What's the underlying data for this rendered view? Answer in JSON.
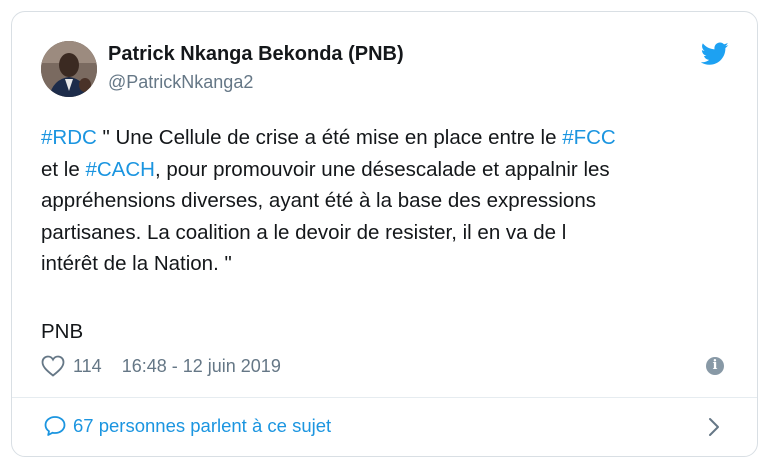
{
  "tweet": {
    "author": {
      "name": "Patrick Nkanga Bekonda (PNB)",
      "handle": "@PatrickNkanga2",
      "avatar_icon": "avatar"
    },
    "text": {
      "line1_tag1": "#RDC",
      "line1_rest": " \" Une Cellule de crise a été mise en place entre le ",
      "line1_tag2": "#FCC",
      "line2_start": "et le ",
      "line2_tag": "#CACH",
      "line2_rest": ", pour promouvoir une désescalade et appalnir les",
      "line3": "appréhensions diverses, ayant été à la base des expressions",
      "line4": "partisanes. La coalition a le devoir de resister, il en va de l",
      "line5": "intérêt de la Nation. \""
    },
    "signature": "PNB",
    "likes": "114",
    "timestamp": "16:48 - 12 juin 2019",
    "footer_label": "67 personnes parlent à ce sujet"
  },
  "colors": {
    "link": "#1b95e0",
    "text": "#14171a",
    "muted": "#657786",
    "twitter_blue": "#1da1f2"
  },
  "icons": [
    "twitter-bird-icon",
    "heart-icon",
    "info-icon",
    "speech-bubble-icon",
    "chevron-right-icon"
  ]
}
